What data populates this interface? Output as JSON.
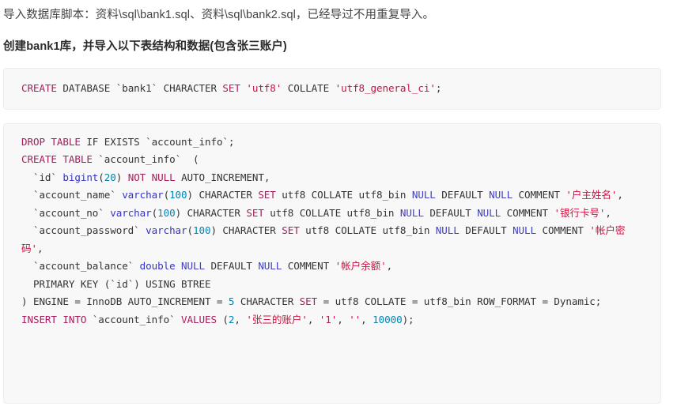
{
  "document": {
    "intro_line": "导入数据库脚本：资料\\sql\\bank1.sql、资料\\sql\\bank2.sql，已经导过不用重复导入。",
    "heading_line": "创建bank1库，并导入以下表结构和数据(包含张三账户)"
  },
  "code_blocks": [
    {
      "id": "create-database",
      "language": "sql",
      "raw": "CREATE DATABASE `bank1` CHARACTER SET 'utf8' COLLATE 'utf8_general_ci';",
      "tokens": [
        {
          "t": "CREATE",
          "c": "k"
        },
        {
          "t": " DATABASE ",
          "c": "pl"
        },
        {
          "t": "`bank1`",
          "c": "id"
        },
        {
          "t": " CHARACTER ",
          "c": "pl"
        },
        {
          "t": "SET",
          "c": "k"
        },
        {
          "t": " ",
          "c": "pl"
        },
        {
          "t": "'utf8'",
          "c": "s"
        },
        {
          "t": " COLLATE ",
          "c": "pl"
        },
        {
          "t": "'utf8_general_ci'",
          "c": "s"
        },
        {
          "t": ";",
          "c": "pl"
        }
      ]
    },
    {
      "id": "create-table",
      "language": "sql",
      "raw": "DROP TABLE IF EXISTS `account_info`;\nCREATE TABLE `account_info`  (\n  `id` bigint(20) NOT NULL AUTO_INCREMENT,\n  `account_name` varchar(100) CHARACTER SET utf8 COLLATE utf8_bin NULL DEFAULT NULL COMMENT '户主姓名',\n  `account_no` varchar(100) CHARACTER SET utf8 COLLATE utf8_bin NULL DEFAULT NULL COMMENT '银行卡号',\n  `account_password` varchar(100) CHARACTER SET utf8 COLLATE utf8_bin NULL DEFAULT NULL COMMENT '帐户密码',\n  `account_balance` double NULL DEFAULT NULL COMMENT '帐户余额',\n  PRIMARY KEY (`id`) USING BTREE\n) ENGINE = InnoDB AUTO_INCREMENT = 5 CHARACTER SET = utf8 COLLATE = utf8_bin ROW_FORMAT = Dynamic;\nINSERT INTO `account_info` VALUES (2, '张三的账户', '1', '', 10000);",
      "tokens": [
        {
          "t": "DROP",
          "c": "k"
        },
        {
          "t": " ",
          "c": "pl"
        },
        {
          "t": "TABLE",
          "c": "k"
        },
        {
          "t": " IF EXISTS ",
          "c": "pl"
        },
        {
          "t": "`account_info`",
          "c": "id"
        },
        {
          "t": ";\n",
          "c": "pl"
        },
        {
          "t": "CREATE",
          "c": "k"
        },
        {
          "t": " ",
          "c": "pl"
        },
        {
          "t": "TABLE",
          "c": "k"
        },
        {
          "t": " ",
          "c": "pl"
        },
        {
          "t": "`account_info`",
          "c": "id"
        },
        {
          "t": "  (\n  ",
          "c": "pl"
        },
        {
          "t": "`id`",
          "c": "id"
        },
        {
          "t": " ",
          "c": "pl"
        },
        {
          "t": "bigint",
          "c": "t"
        },
        {
          "t": "(",
          "c": "pl"
        },
        {
          "t": "20",
          "c": "nu"
        },
        {
          "t": ") ",
          "c": "pl"
        },
        {
          "t": "NOT",
          "c": "k"
        },
        {
          "t": " ",
          "c": "pl"
        },
        {
          "t": "NULL",
          "c": "k"
        },
        {
          "t": " AUTO_INCREMENT,\n  ",
          "c": "pl"
        },
        {
          "t": "`account_name`",
          "c": "id"
        },
        {
          "t": " ",
          "c": "pl"
        },
        {
          "t": "varchar",
          "c": "t"
        },
        {
          "t": "(",
          "c": "pl"
        },
        {
          "t": "100",
          "c": "nu"
        },
        {
          "t": ") CHARACTER ",
          "c": "pl"
        },
        {
          "t": "SET",
          "c": "k"
        },
        {
          "t": " utf8 COLLATE utf8_bin ",
          "c": "pl"
        },
        {
          "t": "NULL",
          "c": "nn"
        },
        {
          "t": " DEFAULT ",
          "c": "pl"
        },
        {
          "t": "NULL",
          "c": "nn"
        },
        {
          "t": " COMMENT ",
          "c": "pl"
        },
        {
          "t": "'户主姓名'",
          "c": "s"
        },
        {
          "t": ",\n  ",
          "c": "pl"
        },
        {
          "t": "`account_no`",
          "c": "id"
        },
        {
          "t": " ",
          "c": "pl"
        },
        {
          "t": "varchar",
          "c": "t"
        },
        {
          "t": "(",
          "c": "pl"
        },
        {
          "t": "100",
          "c": "nu"
        },
        {
          "t": ") CHARACTER ",
          "c": "pl"
        },
        {
          "t": "SET",
          "c": "k"
        },
        {
          "t": " utf8 COLLATE utf8_bin ",
          "c": "pl"
        },
        {
          "t": "NULL",
          "c": "nn"
        },
        {
          "t": " DEFAULT ",
          "c": "pl"
        },
        {
          "t": "NULL",
          "c": "nn"
        },
        {
          "t": " COMMENT ",
          "c": "pl"
        },
        {
          "t": "'银行卡号'",
          "c": "s"
        },
        {
          "t": ",\n  ",
          "c": "pl"
        },
        {
          "t": "`account_password`",
          "c": "id"
        },
        {
          "t": " ",
          "c": "pl"
        },
        {
          "t": "varchar",
          "c": "t"
        },
        {
          "t": "(",
          "c": "pl"
        },
        {
          "t": "100",
          "c": "nu"
        },
        {
          "t": ") CHARACTER ",
          "c": "pl"
        },
        {
          "t": "SET",
          "c": "k"
        },
        {
          "t": " utf8 COLLATE utf8_bin ",
          "c": "pl"
        },
        {
          "t": "NULL",
          "c": "nn"
        },
        {
          "t": " DEFAULT ",
          "c": "pl"
        },
        {
          "t": "NULL",
          "c": "nn"
        },
        {
          "t": " COMMENT ",
          "c": "pl"
        },
        {
          "t": "'帐户密码'",
          "c": "s"
        },
        {
          "t": ",\n  ",
          "c": "pl"
        },
        {
          "t": "`account_balance`",
          "c": "id"
        },
        {
          "t": " ",
          "c": "pl"
        },
        {
          "t": "double",
          "c": "t"
        },
        {
          "t": " ",
          "c": "pl"
        },
        {
          "t": "NULL",
          "c": "nn"
        },
        {
          "t": " DEFAULT ",
          "c": "pl"
        },
        {
          "t": "NULL",
          "c": "nn"
        },
        {
          "t": " COMMENT ",
          "c": "pl"
        },
        {
          "t": "'帐户余额'",
          "c": "s"
        },
        {
          "t": ",\n  PRIMARY KEY (",
          "c": "pl"
        },
        {
          "t": "`id`",
          "c": "id"
        },
        {
          "t": ") USING BTREE\n) ENGINE = InnoDB AUTO_INCREMENT = ",
          "c": "pl"
        },
        {
          "t": "5",
          "c": "nu"
        },
        {
          "t": " CHARACTER ",
          "c": "pl"
        },
        {
          "t": "SET",
          "c": "k"
        },
        {
          "t": " = utf8 COLLATE = utf8_bin ROW_FORMAT = Dynamic;\n",
          "c": "pl"
        },
        {
          "t": "INSERT",
          "c": "k"
        },
        {
          "t": " ",
          "c": "pl"
        },
        {
          "t": "INTO",
          "c": "k"
        },
        {
          "t": " ",
          "c": "pl"
        },
        {
          "t": "`account_info`",
          "c": "id"
        },
        {
          "t": " ",
          "c": "pl"
        },
        {
          "t": "VALUES",
          "c": "k"
        },
        {
          "t": " (",
          "c": "pl"
        },
        {
          "t": "2",
          "c": "nu"
        },
        {
          "t": ", ",
          "c": "pl"
        },
        {
          "t": "'张三的账户'",
          "c": "s"
        },
        {
          "t": ", ",
          "c": "pl"
        },
        {
          "t": "'1'",
          "c": "s"
        },
        {
          "t": ", ",
          "c": "pl"
        },
        {
          "t": "''",
          "c": "s"
        },
        {
          "t": ", ",
          "c": "pl"
        },
        {
          "t": "10000",
          "c": "nu"
        },
        {
          "t": ");",
          "c": "pl"
        }
      ]
    }
  ],
  "colors": {
    "page_background": "#ffffff",
    "code_background": "#f8f8f8",
    "code_border": "#eeeeee",
    "text": "#444444",
    "keyword": "#a71d5d",
    "string": "#d01040",
    "type": "#3333cc",
    "number": "#0086b3",
    "null_literal": "#4040c0",
    "identifier": "#333333"
  }
}
